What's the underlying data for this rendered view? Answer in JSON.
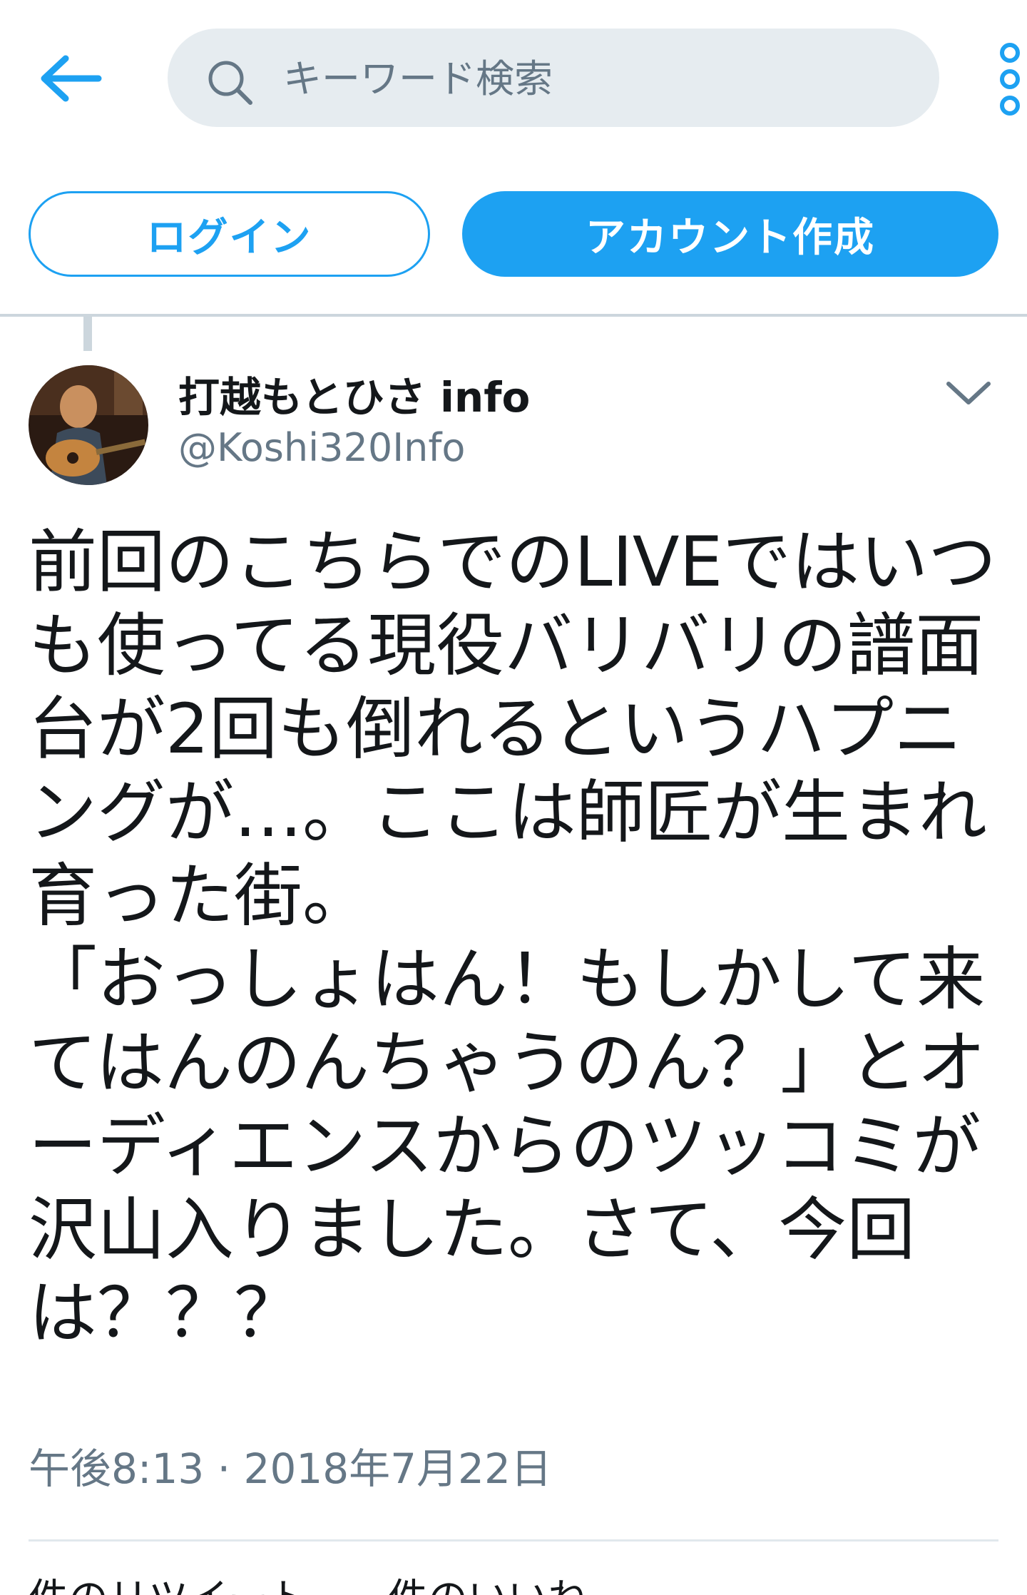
{
  "header": {
    "search_placeholder": "キーワード検索",
    "back_icon": "arrow-left-icon",
    "more_icon": "vertical-dots-icon",
    "accent": "#1da1f2"
  },
  "auth": {
    "login_label": "ログイン",
    "signup_label": "アカウント作成"
  },
  "tweet": {
    "author_name": "打越もとひさ info",
    "author_handle": "@Koshi320Info",
    "text_lines": [
      "前回のこちらでのLIVEではいつ",
      "も使ってる現役バリバリの譜面",
      "台が2回も倒れるというハプニ",
      "ングが…。ここは師匠が生まれ",
      "育った街。",
      "「おっしょはん！もしかして来",
      "てはんのんちゃうのん？」とオ",
      "ーディエンスからのツッコミが",
      "沢山入りました。さて、今回",
      "は？？？"
    ],
    "timestamp": "午後8:13 · 2018年7月22日",
    "stats_partial": "件のリツイート　　件のいいね"
  }
}
